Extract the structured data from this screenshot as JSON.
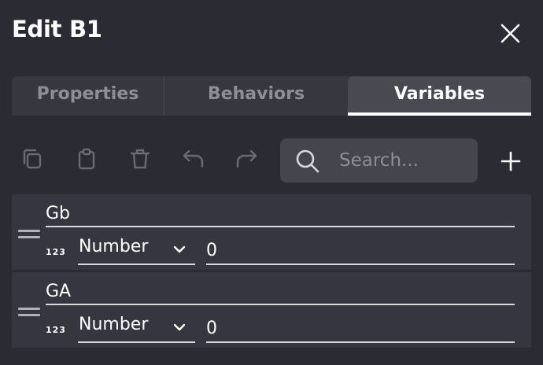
{
  "dialog": {
    "title": "Edit B1",
    "close_icon": "close-icon"
  },
  "tabs": [
    {
      "label": "Properties",
      "active": false
    },
    {
      "label": "Behaviors",
      "active": false
    },
    {
      "label": "Variables",
      "active": true
    }
  ],
  "toolbar": {
    "icons": [
      "copy-icon",
      "paste-icon",
      "delete-icon",
      "undo-icon",
      "redo-icon"
    ],
    "search": {
      "placeholder": "Search...",
      "value": ""
    },
    "add_icon": "plus-icon"
  },
  "variables": [
    {
      "name": "Gb",
      "type_badge": "123",
      "type": "Number",
      "value": "0"
    },
    {
      "name": "GA",
      "type_badge": "123",
      "type": "Number",
      "value": "0"
    }
  ],
  "colors": {
    "background": "#2b2b33",
    "tab_bar": "#373740",
    "tab_active": "#494952",
    "row": "#363640",
    "muted_text": "#8e8e96"
  }
}
